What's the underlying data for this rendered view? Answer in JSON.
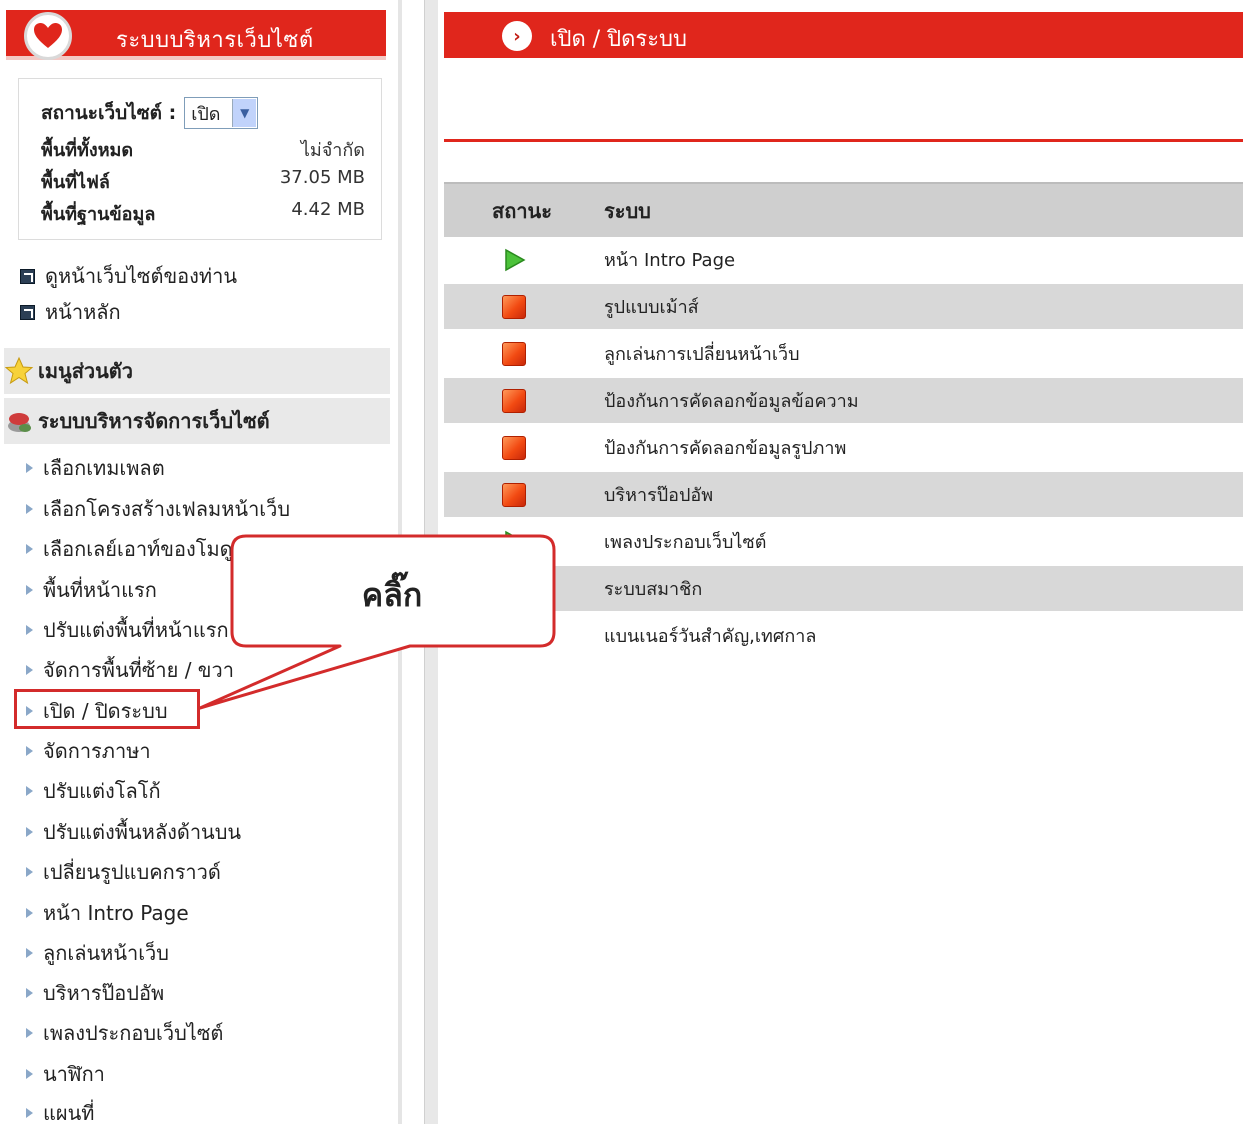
{
  "sidebar": {
    "title": "ระบบบริหารเว็บไซต์",
    "status_label": "สถานะเว็บไซต์ :",
    "status_value": "เปิด",
    "stats": [
      {
        "label": "พื้นที่ทั้งหมด",
        "value": "ไม่จำกัด"
      },
      {
        "label": "พื้นที่ไฟล์",
        "value": "37.05 MB"
      },
      {
        "label": "พื้นที่ฐานข้อมูล",
        "value": "4.42 MB"
      }
    ],
    "links": [
      {
        "label": "ดูหน้าเว็บไซต์ของท่าน"
      },
      {
        "label": "หน้าหลัก"
      }
    ],
    "sections": {
      "personal": "เมนูส่วนตัว",
      "management": "ระบบบริหารจัดการเว็บไซต์"
    },
    "menu": [
      "เลือกเทมเพลต",
      "เลือกโครงสร้างเฟลมหน้าเว็บ",
      "เลือกเลย์เอาท์ของโมดูล",
      "พื้นที่หน้าแรก",
      "ปรับแต่งพื้นที่หน้าแรก",
      "จัดการพื้นที่ซ้าย / ขวา",
      "เปิด / ปิดระบบ",
      "จัดการภาษา",
      "ปรับแต่งโลโก้",
      "ปรับแต่งพื้นหลังด้านบน",
      "เปลี่ยนรูปแบคกราวด์",
      "หน้า Intro Page",
      "ลูกเล่นหน้าเว็บ",
      "บริหารป๊อปอัพ",
      "เพลงประกอบเว็บไซต์",
      "นาฬิกา",
      "แผนที่"
    ]
  },
  "main": {
    "title": "เปิด / ปิดระบบ",
    "table": {
      "headers": {
        "status": "สถานะ",
        "system": "ระบบ"
      },
      "rows": [
        {
          "status": "on",
          "name": "หน้า Intro Page"
        },
        {
          "status": "off",
          "name": "รูปแบบเม้าส์"
        },
        {
          "status": "off",
          "name": "ลูกเล่นการเปลี่ยนหน้าเว็บ"
        },
        {
          "status": "off",
          "name": "ป้องกันการคัดลอกข้อมูลข้อความ"
        },
        {
          "status": "off",
          "name": "ป้องกันการคัดลอกข้อมูลรูปภาพ"
        },
        {
          "status": "off",
          "name": "บริหารป๊อปอัพ"
        },
        {
          "status": "on",
          "name": "เพลงประกอบเว็บไซต์"
        },
        {
          "status": "on",
          "name": "ระบบสมาชิก"
        },
        {
          "status": "on",
          "name": "แบนเนอร์วันสำคัญ,เทศกาล"
        }
      ]
    }
  },
  "callout": {
    "text": "คลิ๊ก"
  },
  "colors": {
    "accent": "#e0261c",
    "row_alt": "#d8d8d8",
    "header_row": "#cfcfcf"
  }
}
